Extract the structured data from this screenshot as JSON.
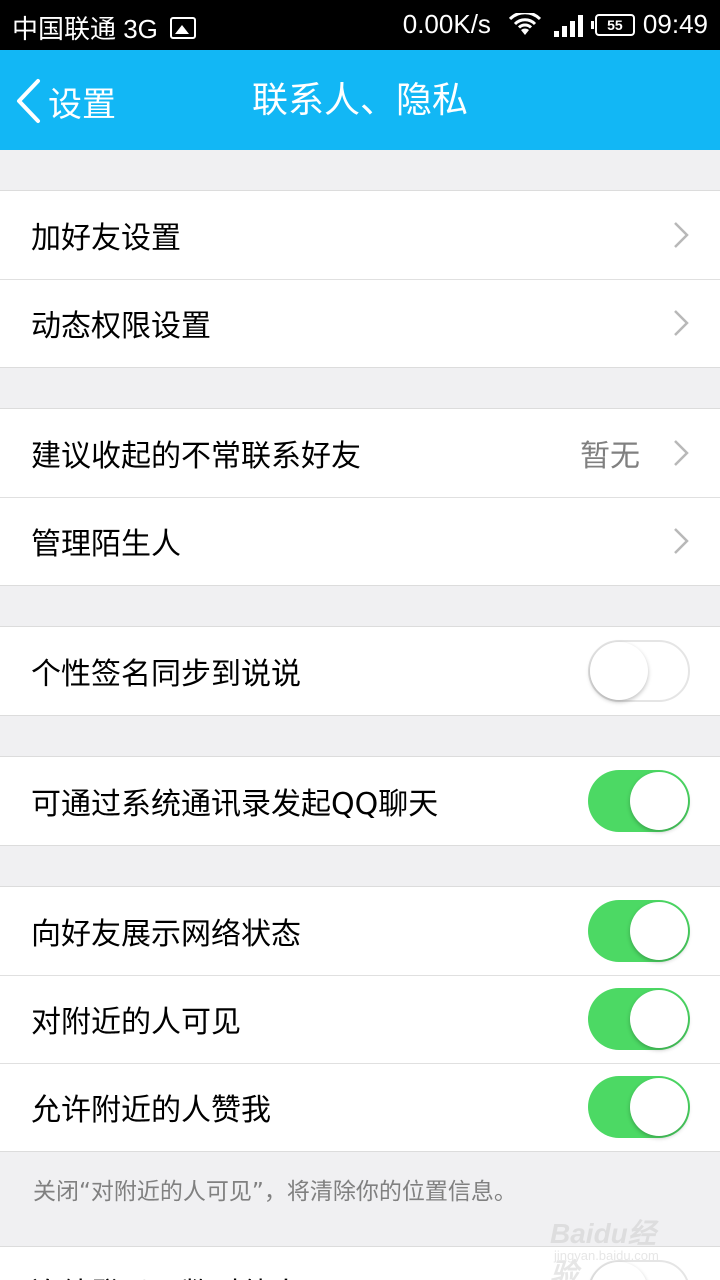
{
  "status_bar": {
    "carrier": "中国联通 3G",
    "speed": "0.00K/s",
    "battery": "55",
    "time": "09:49"
  },
  "nav": {
    "back_label": "设置",
    "title": "联系人、隐私"
  },
  "groups": [
    {
      "rows": [
        {
          "label": "加好友设置",
          "type": "chevron"
        },
        {
          "label": "动态权限设置",
          "type": "chevron"
        }
      ]
    },
    {
      "rows": [
        {
          "label": "建议收起的不常联系好友",
          "value": "暂无",
          "type": "chevron"
        },
        {
          "label": "管理陌生人",
          "type": "chevron"
        }
      ]
    },
    {
      "rows": [
        {
          "label": "个性签名同步到说说",
          "type": "toggle",
          "on": false
        }
      ]
    },
    {
      "rows": [
        {
          "label": "可通过系统通讯录发起QQ聊天",
          "type": "toggle",
          "on": true
        }
      ]
    },
    {
      "rows": [
        {
          "label": "向好友展示网络状态",
          "type": "toggle",
          "on": true
        },
        {
          "label": "对附近的人可见",
          "type": "toggle",
          "on": true
        },
        {
          "label": "允许附近的人赞我",
          "type": "toggle",
          "on": true
        }
      ]
    }
  ],
  "note": "关闭“对附近的人可见”，将清除你的位置信息。",
  "last_row": {
    "label": "连续登录天数对他人可见",
    "type": "toggle",
    "on": false
  },
  "watermark": {
    "text": "Baidu经验",
    "sub": "jingyan.baidu.com"
  },
  "colors": {
    "nav_bg": "#12b7f5",
    "toggle_on": "#4cd964",
    "page_bg": "#f0f0f2"
  }
}
